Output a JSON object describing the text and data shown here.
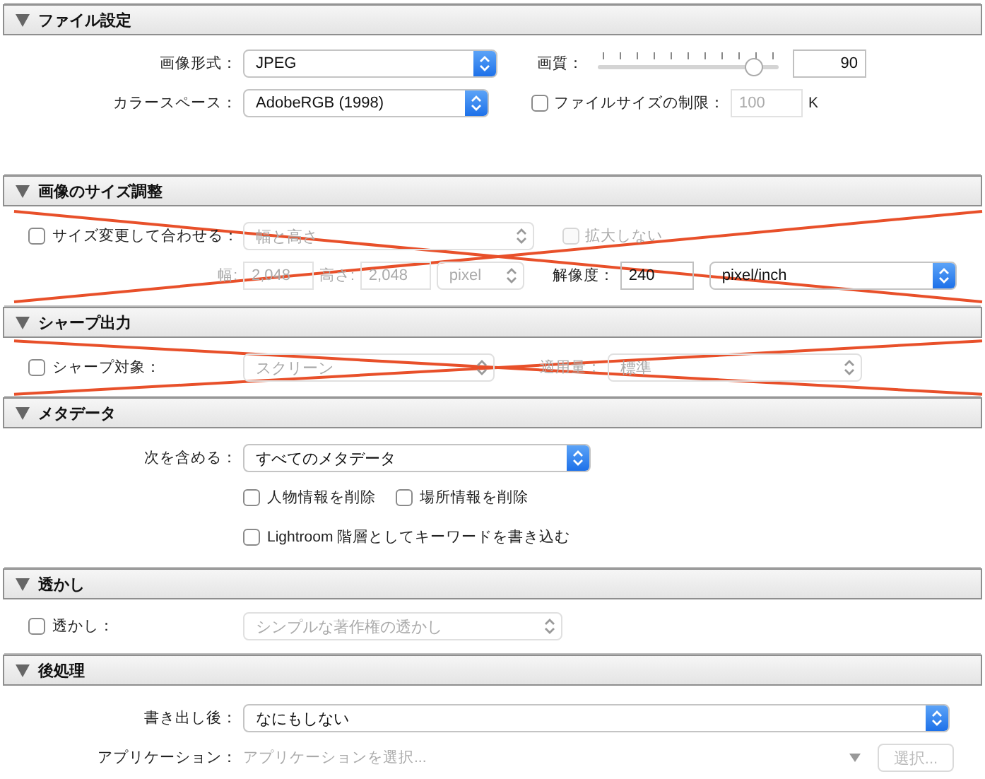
{
  "sections": [
    {
      "kind": "file",
      "title": "ファイル設定",
      "expanded": true,
      "format": {
        "label": "画像形式：",
        "value": "JPEG"
      },
      "quality": {
        "label": "画質：",
        "level": 0.86,
        "value": "90"
      },
      "color_space": {
        "label": "カラースペース：",
        "value": "AdobeRGB (1998)"
      },
      "size_limit": {
        "label": "ファイルサイズの制限：",
        "checked": false,
        "value": "100",
        "unit": "K"
      }
    },
    {
      "kind": "resize",
      "title": "画像のサイズ調整",
      "expanded": true,
      "crossed_out": true,
      "resize": {
        "label": "サイズ変更して合わせる：",
        "checked": false,
        "value": "幅と高さ",
        "disabled": true
      },
      "no_enlarge": {
        "label": "拡大しない",
        "checked": false,
        "disabled": true
      },
      "width": {
        "label": "幅:",
        "value": "2,048",
        "disabled": true
      },
      "height": {
        "label": "高さ:",
        "value": "2,048",
        "disabled": true
      },
      "unit": {
        "value": "pixel",
        "disabled": true
      },
      "resolution": {
        "label": "解像度：",
        "value": "240",
        "unit": "pixel/inch"
      }
    },
    {
      "kind": "sharpen",
      "title": "シャープ出力",
      "expanded": true,
      "crossed_out": true,
      "sharpen": {
        "label": "シャープ対象：",
        "checked": false,
        "value": "スクリーン",
        "disabled": true
      },
      "amount": {
        "label": "適用量：",
        "value": "標準",
        "disabled": true
      }
    },
    {
      "kind": "metadata",
      "title": "メタデータ",
      "expanded": true,
      "include": {
        "label": "次を含める：",
        "value": "すべてのメタデータ"
      },
      "options": [
        {
          "label": "人物情報を削除",
          "checked": false
        },
        {
          "label": "場所情報を削除",
          "checked": false
        },
        {
          "label": "Lightroom 階層としてキーワードを書き込む",
          "checked": false
        }
      ]
    },
    {
      "kind": "watermark",
      "title": "透かし",
      "expanded": true,
      "watermark": {
        "label": "透かし：",
        "checked": false,
        "value": "シンプルな著作権の透かし",
        "disabled": true
      }
    },
    {
      "kind": "post",
      "title": "後処理",
      "expanded": true,
      "after_export": {
        "label": "書き出し後：",
        "value": "なにもしない"
      },
      "application": {
        "label": "アプリケーション：",
        "placeholder": "アプリケーションを選択...",
        "button": "選択...",
        "disabled": true
      }
    }
  ]
}
